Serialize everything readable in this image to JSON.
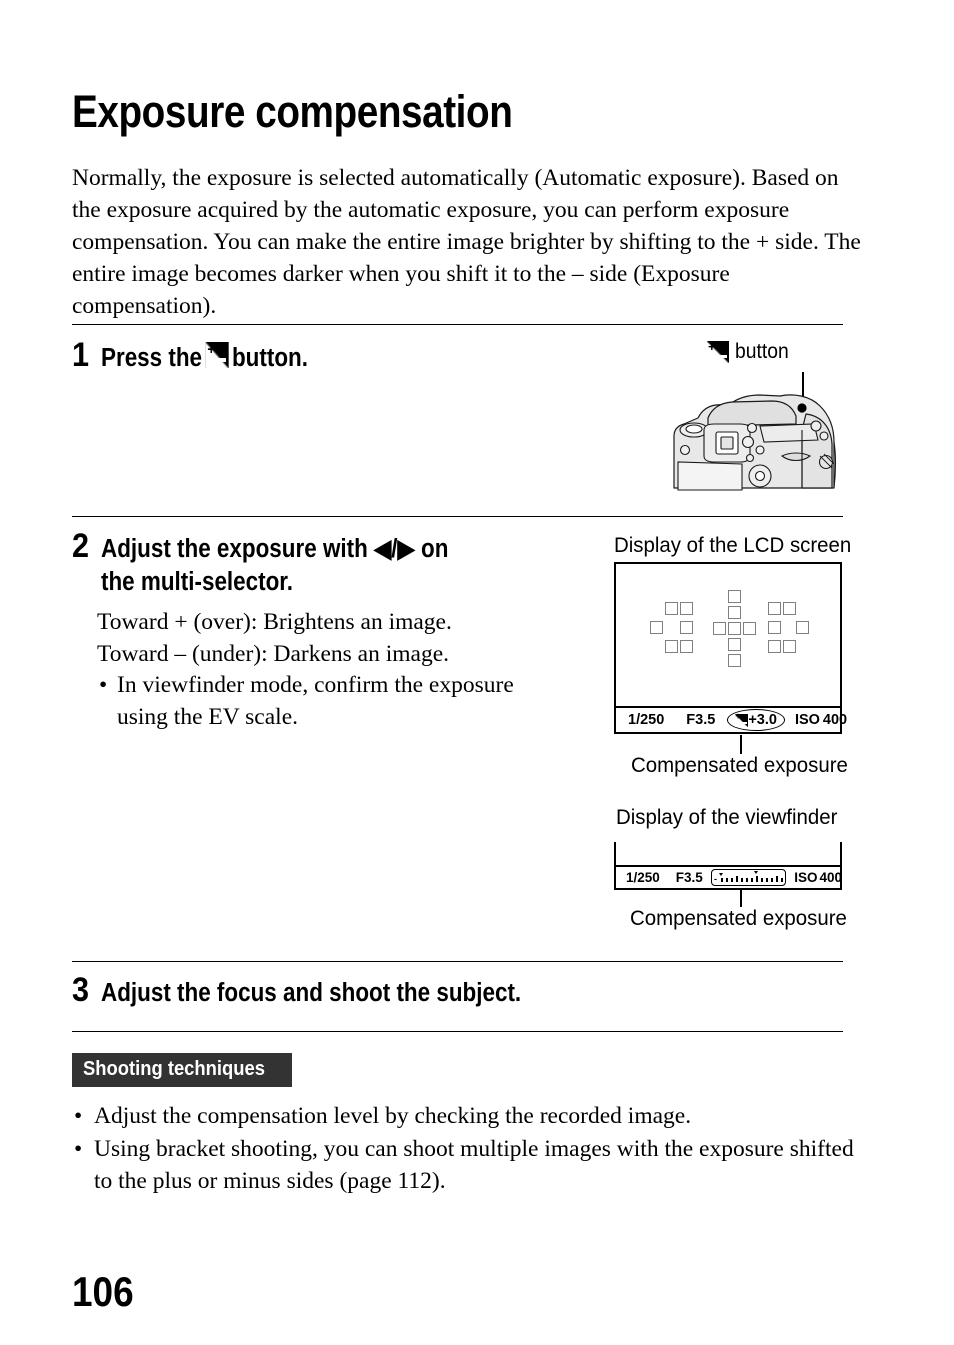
{
  "page": {
    "title": "Exposure compensation",
    "number": "106"
  },
  "intro": "Normally, the exposure is selected automatically (Automatic exposure). Based on the exposure acquired by the automatic exposure, you can perform exposure compensation. You can make the entire image brighter by shifting to the + side. The entire image becomes darker when you shift it to the – side (Exposure compensation).",
  "steps": [
    {
      "number": "1",
      "text_before_icon": "Press the",
      "icon": "exposure-compensation-icon",
      "text_after_icon": "button."
    },
    {
      "number": "2",
      "line1": "Adjust the exposure with ◀/▶ on",
      "line2": "the multi-selector.",
      "body": {
        "line_over": "Toward + (over): Brightens an image.",
        "line_under": "Toward – (under): Darkens an image.",
        "bullet": "In viewfinder mode, confirm the exposure using the EV scale."
      }
    },
    {
      "number": "3",
      "line1": "Adjust the focus and shoot the subject."
    }
  ],
  "callout": {
    "button_icon": "exposure-compensation-icon",
    "button_label": "button"
  },
  "figures": {
    "lcd": {
      "caption": "Display of the LCD screen",
      "annotation": "Compensated exposure",
      "status_bar": {
        "shutter_speed": "1/250",
        "aperture": "F3.5",
        "ev_icon": "exposure-compensation-icon",
        "ev_value": "+3.0",
        "iso_label": "ISO",
        "iso_value": "400"
      },
      "af_points": {
        "description": "autofocus point clusters",
        "left_cluster": [
          [
            1,
            0
          ],
          [
            2,
            0
          ],
          [
            0,
            1
          ],
          [
            2,
            1
          ],
          [
            1,
            2
          ],
          [
            2,
            2
          ]
        ],
        "center_cluster": [
          [
            1,
            -1
          ],
          [
            1,
            0
          ],
          [
            0,
            1
          ],
          [
            1,
            1
          ],
          [
            2,
            1
          ],
          [
            1,
            2
          ],
          [
            1,
            3
          ]
        ],
        "right_cluster": [
          [
            1,
            0
          ],
          [
            2,
            0
          ],
          [
            0,
            1
          ],
          [
            2,
            1
          ],
          [
            1,
            2
          ],
          [
            2,
            2
          ]
        ]
      }
    },
    "viewfinder": {
      "caption": "Display of the viewfinder",
      "annotation": "Compensated exposure",
      "status_bar": {
        "shutter_speed": "1/250",
        "aperture": "F3.5",
        "ev_scale": "ev-scale-bar",
        "iso_label": "ISO",
        "iso_value": "400"
      }
    }
  },
  "shooting_techniques": {
    "badge": "Shooting techniques",
    "tips": [
      "Adjust the compensation level by checking the recorded image.",
      "Using bracket shooting, you can shoot multiple images with the exposure shifted to the plus or minus sides (page 112)."
    ]
  },
  "colors": {
    "text": "#000000",
    "badge_background": "#333333",
    "badge_text": "#ffffff",
    "af_point_outline": "#808080",
    "page_background": "#ffffff"
  }
}
